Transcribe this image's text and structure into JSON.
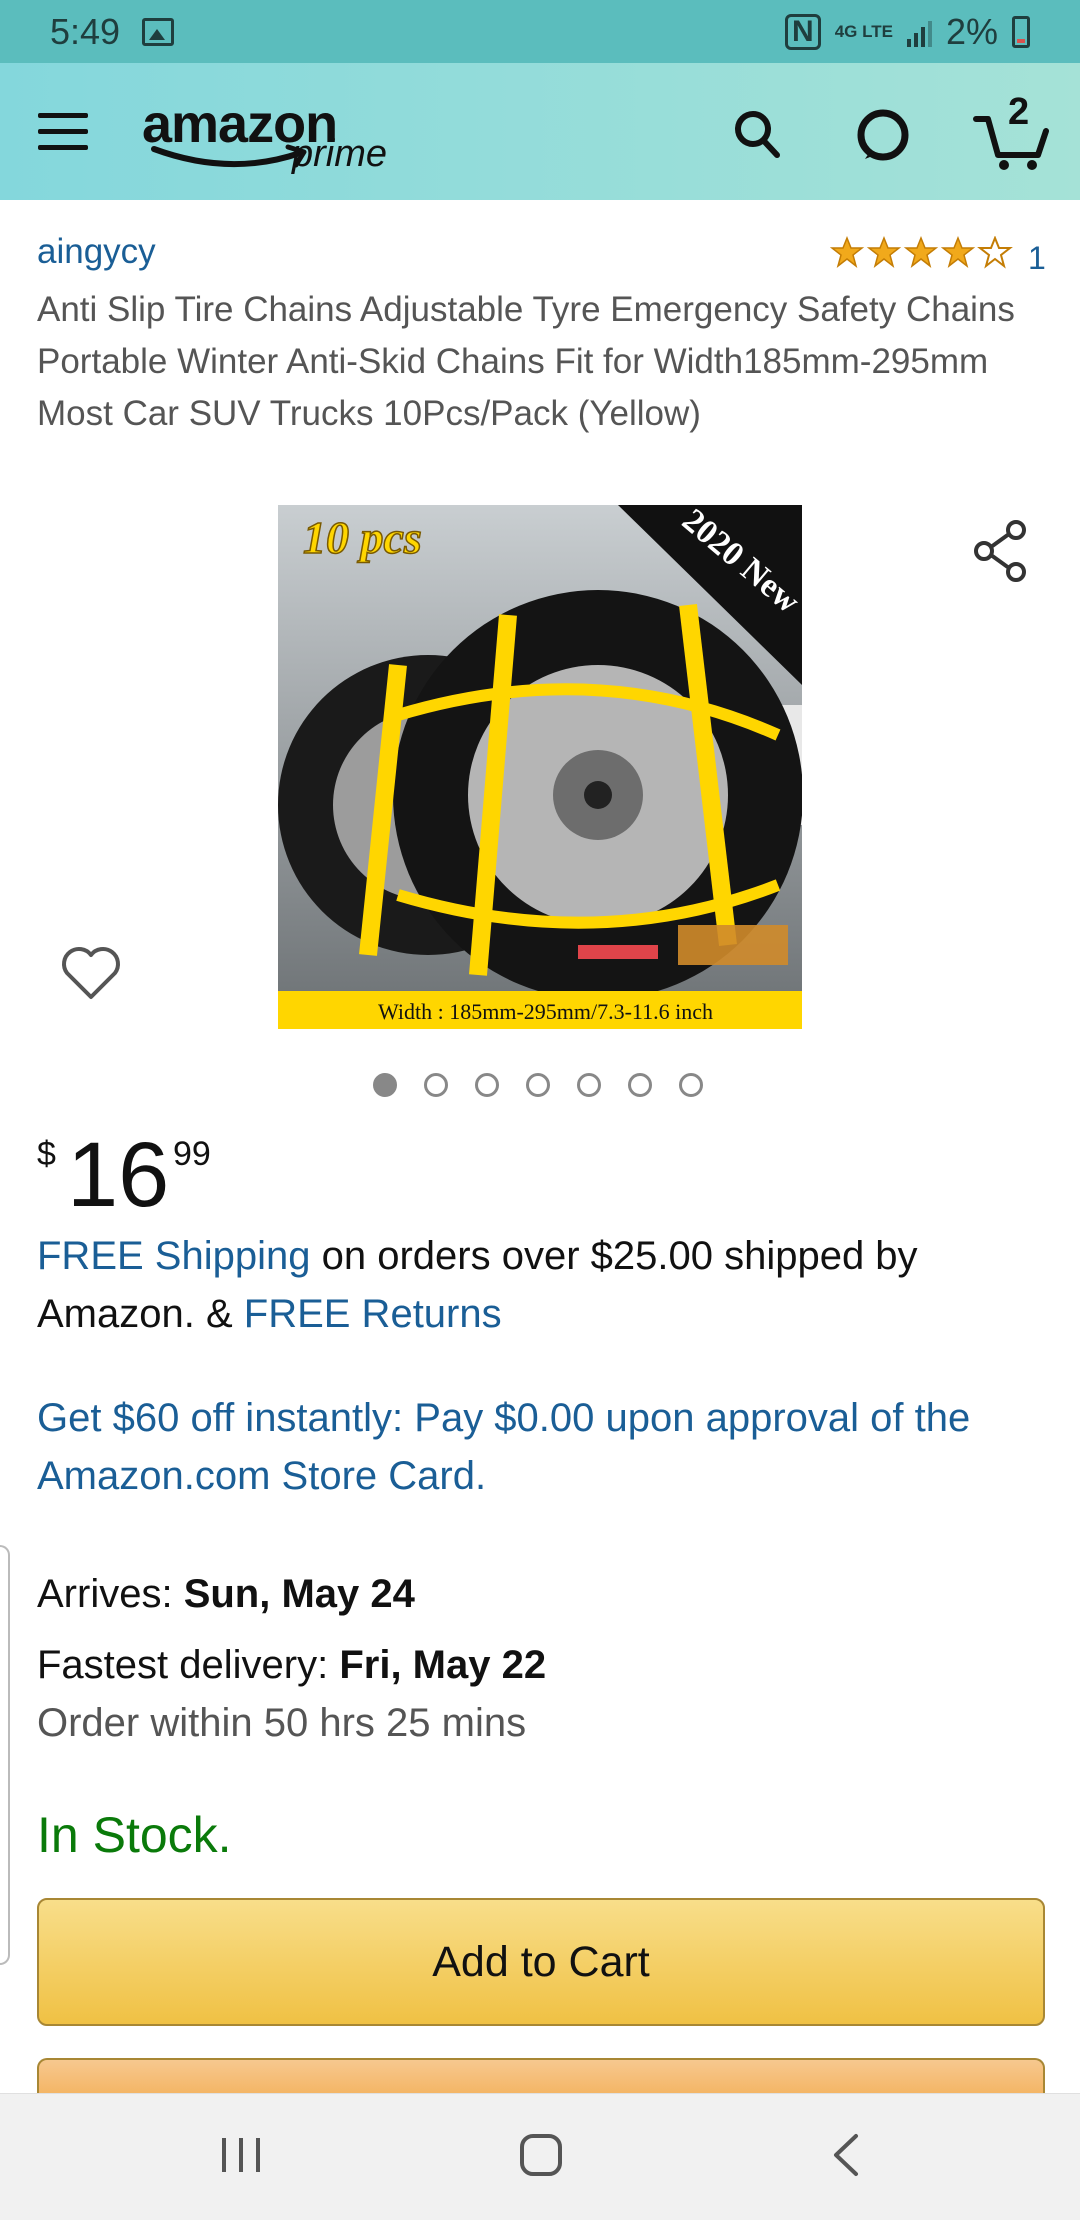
{
  "status_bar": {
    "time": "5:49",
    "network_label": "4G LTE",
    "battery": "2%",
    "nfc_label": "N"
  },
  "header": {
    "logo_text": "amazon",
    "logo_sub": "prime",
    "cart_count": "2",
    "icons": [
      "menu-icon",
      "search-icon",
      "alexa-icon",
      "cart-icon"
    ]
  },
  "product": {
    "brand": "aingycy",
    "rating_stars": 4,
    "rating_count": "1",
    "title": "Anti Slip Tire Chains Adjustable Tyre Emergency Safety Chains Portable Winter Anti-Skid Chains Fit for Width185mm-295mm Most Car SUV Trucks 10Pcs/Pack (Yellow)",
    "image": {
      "badge_pcs": "10 pcs",
      "badge_year": "2020 New",
      "width_caption": "Width : 185mm-295mm/7.3-11.6 inch"
    },
    "image_count": 7,
    "active_image": 1
  },
  "price": {
    "symbol": "$",
    "whole": "16",
    "fraction": "99"
  },
  "shipping": {
    "free_shipping_link": "FREE Shipping",
    "text_middle": " on orders over $25.00 shipped by Amazon. & ",
    "free_returns_link": "FREE Returns"
  },
  "promo": {
    "store_card_text": "Get $60 off instantly: Pay $0.00 upon approval of the Amazon.com Store Card."
  },
  "delivery": {
    "arrives_label": "Arrives: ",
    "arrives_date": "Sun, May 24",
    "fastest_label": "Fastest delivery: ",
    "fastest_date": "Fri, May 22",
    "order_within": "Order within 50 hrs 25 mins"
  },
  "stock": {
    "status": "In Stock."
  },
  "buttons": {
    "add_to_cart": "Add to Cart"
  },
  "colors": {
    "link": "#1a5e96",
    "in_stock": "#0a7a0a",
    "add_to_cart": "#f0c144",
    "header": "#84d7dc"
  }
}
